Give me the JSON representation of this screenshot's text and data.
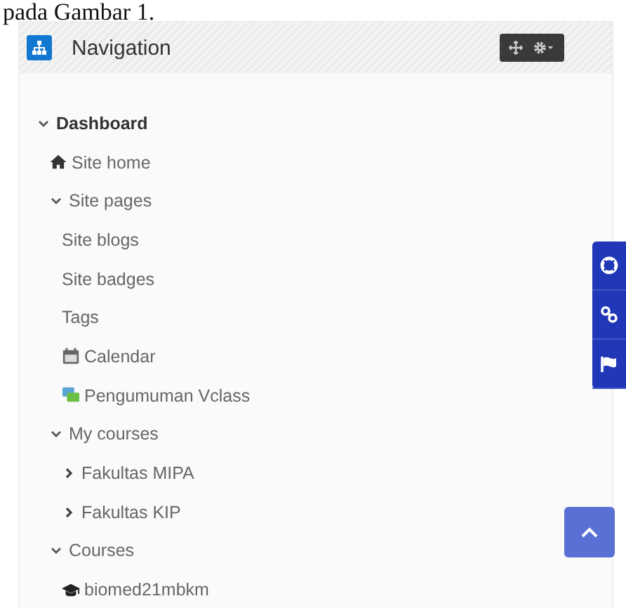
{
  "caption": "pada Gambar 1.",
  "block": {
    "title": "Navigation"
  },
  "tree": [
    {
      "label": "Dashboard",
      "expanded": true,
      "children": [
        {
          "label": "Site home",
          "kind": "home"
        },
        {
          "label": "Site pages",
          "expanded": true,
          "children": [
            {
              "label": "Site blogs"
            },
            {
              "label": "Site badges"
            },
            {
              "label": "Tags"
            },
            {
              "label": "Calendar",
              "kind": "calendar"
            },
            {
              "label": "Pengumuman Vclass",
              "kind": "forum"
            }
          ]
        },
        {
          "label": "My courses",
          "expanded": true,
          "children": [
            {
              "label": "Fakultas MIPA",
              "expanded": false
            },
            {
              "label": "Fakultas KIP",
              "expanded": false
            }
          ]
        },
        {
          "label": "Courses",
          "expanded": true,
          "children": [
            {
              "label": "biomed21mbkm",
              "kind": "course"
            }
          ]
        }
      ]
    }
  ]
}
